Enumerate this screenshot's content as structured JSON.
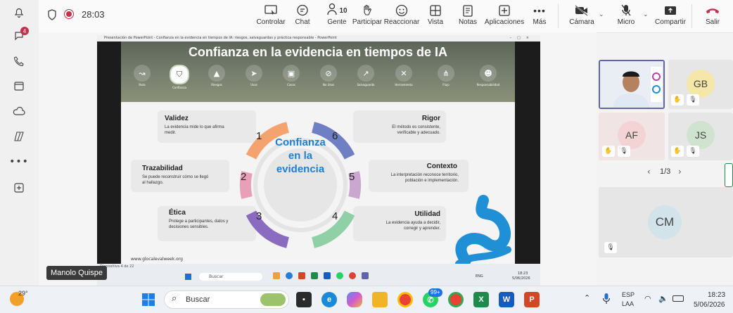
{
  "rail": {
    "chat_badge": "4"
  },
  "call": {
    "time": "28:03"
  },
  "toolbar": {
    "controlar": "Controlar",
    "chat": "Chat",
    "people_count": "10",
    "gente": "Gente",
    "participar": "Participar",
    "reaccionar": "Reaccionar",
    "vista": "Vista",
    "notas": "Notas",
    "aplicaciones": "Aplicaciones",
    "mas": "Más",
    "camara": "Cámara",
    "micro": "Micro",
    "compartir": "Compartir",
    "salir": "Salir"
  },
  "ppt": {
    "titlebar": "Presentación de PowerPoint  -  Confianza en la evidencia en tiempos de IA: riesgos, salvaguardas y práctica responsable  -  PowerPoint",
    "slide_title": "Confianza en la evidencia en tiempos de IA",
    "nav": [
      "Ruta",
      "Confianza",
      "Riesgos",
      "Usos",
      "Casos",
      "No Usos",
      "Salvaguarda",
      "Herramienta",
      "Flujo",
      "Responsabilidad"
    ],
    "center": [
      "Confianza",
      "en la",
      "evidencia"
    ],
    "cards": [
      {
        "num": "1",
        "title": "Validez",
        "desc": "La evidencia mide lo que afirma medir."
      },
      {
        "num": "2",
        "title": "Trazabilidad",
        "desc": "Se puede reconstruir cómo se llegó al hallazgo."
      },
      {
        "num": "3",
        "title": "Ética",
        "desc": "Protege a participantes, datos y decisiones sensibles."
      },
      {
        "num": "6",
        "title": "Rigor",
        "desc": "El método es consistente, verificable y adecuado."
      },
      {
        "num": "5",
        "title": "Contexto",
        "desc": "La interpretación reconoce territorio, población e implementación."
      },
      {
        "num": "4",
        "title": "Utilidad",
        "desc": "La evidencia ayuda a decidir, corregir y aprender."
      }
    ],
    "url": "www.glocalevalweek.org",
    "status": "Diapositiva 4 de 22",
    "inner_search": "Buscar",
    "inner_lang": "ENG",
    "inner_time": "18:23",
    "inner_date": "5/06/2026"
  },
  "presenter_label": "Manolo Quispe",
  "participants": {
    "tiles": [
      {
        "initials": "GB",
        "color": "#f5e7a8"
      },
      {
        "initials": "AF",
        "color": "#f3d3d3"
      },
      {
        "initials": "JS",
        "color": "#cfe3cf"
      },
      {
        "initials": "CM",
        "color": "#d3e3ea"
      }
    ],
    "pager": "1/3"
  },
  "taskbar": {
    "weather": "29°",
    "search": "Buscar",
    "whatsapp_badge": "99+",
    "lang1": "ESP",
    "lang2": "LAA",
    "time": "18:23",
    "date": "5/06/2026"
  }
}
